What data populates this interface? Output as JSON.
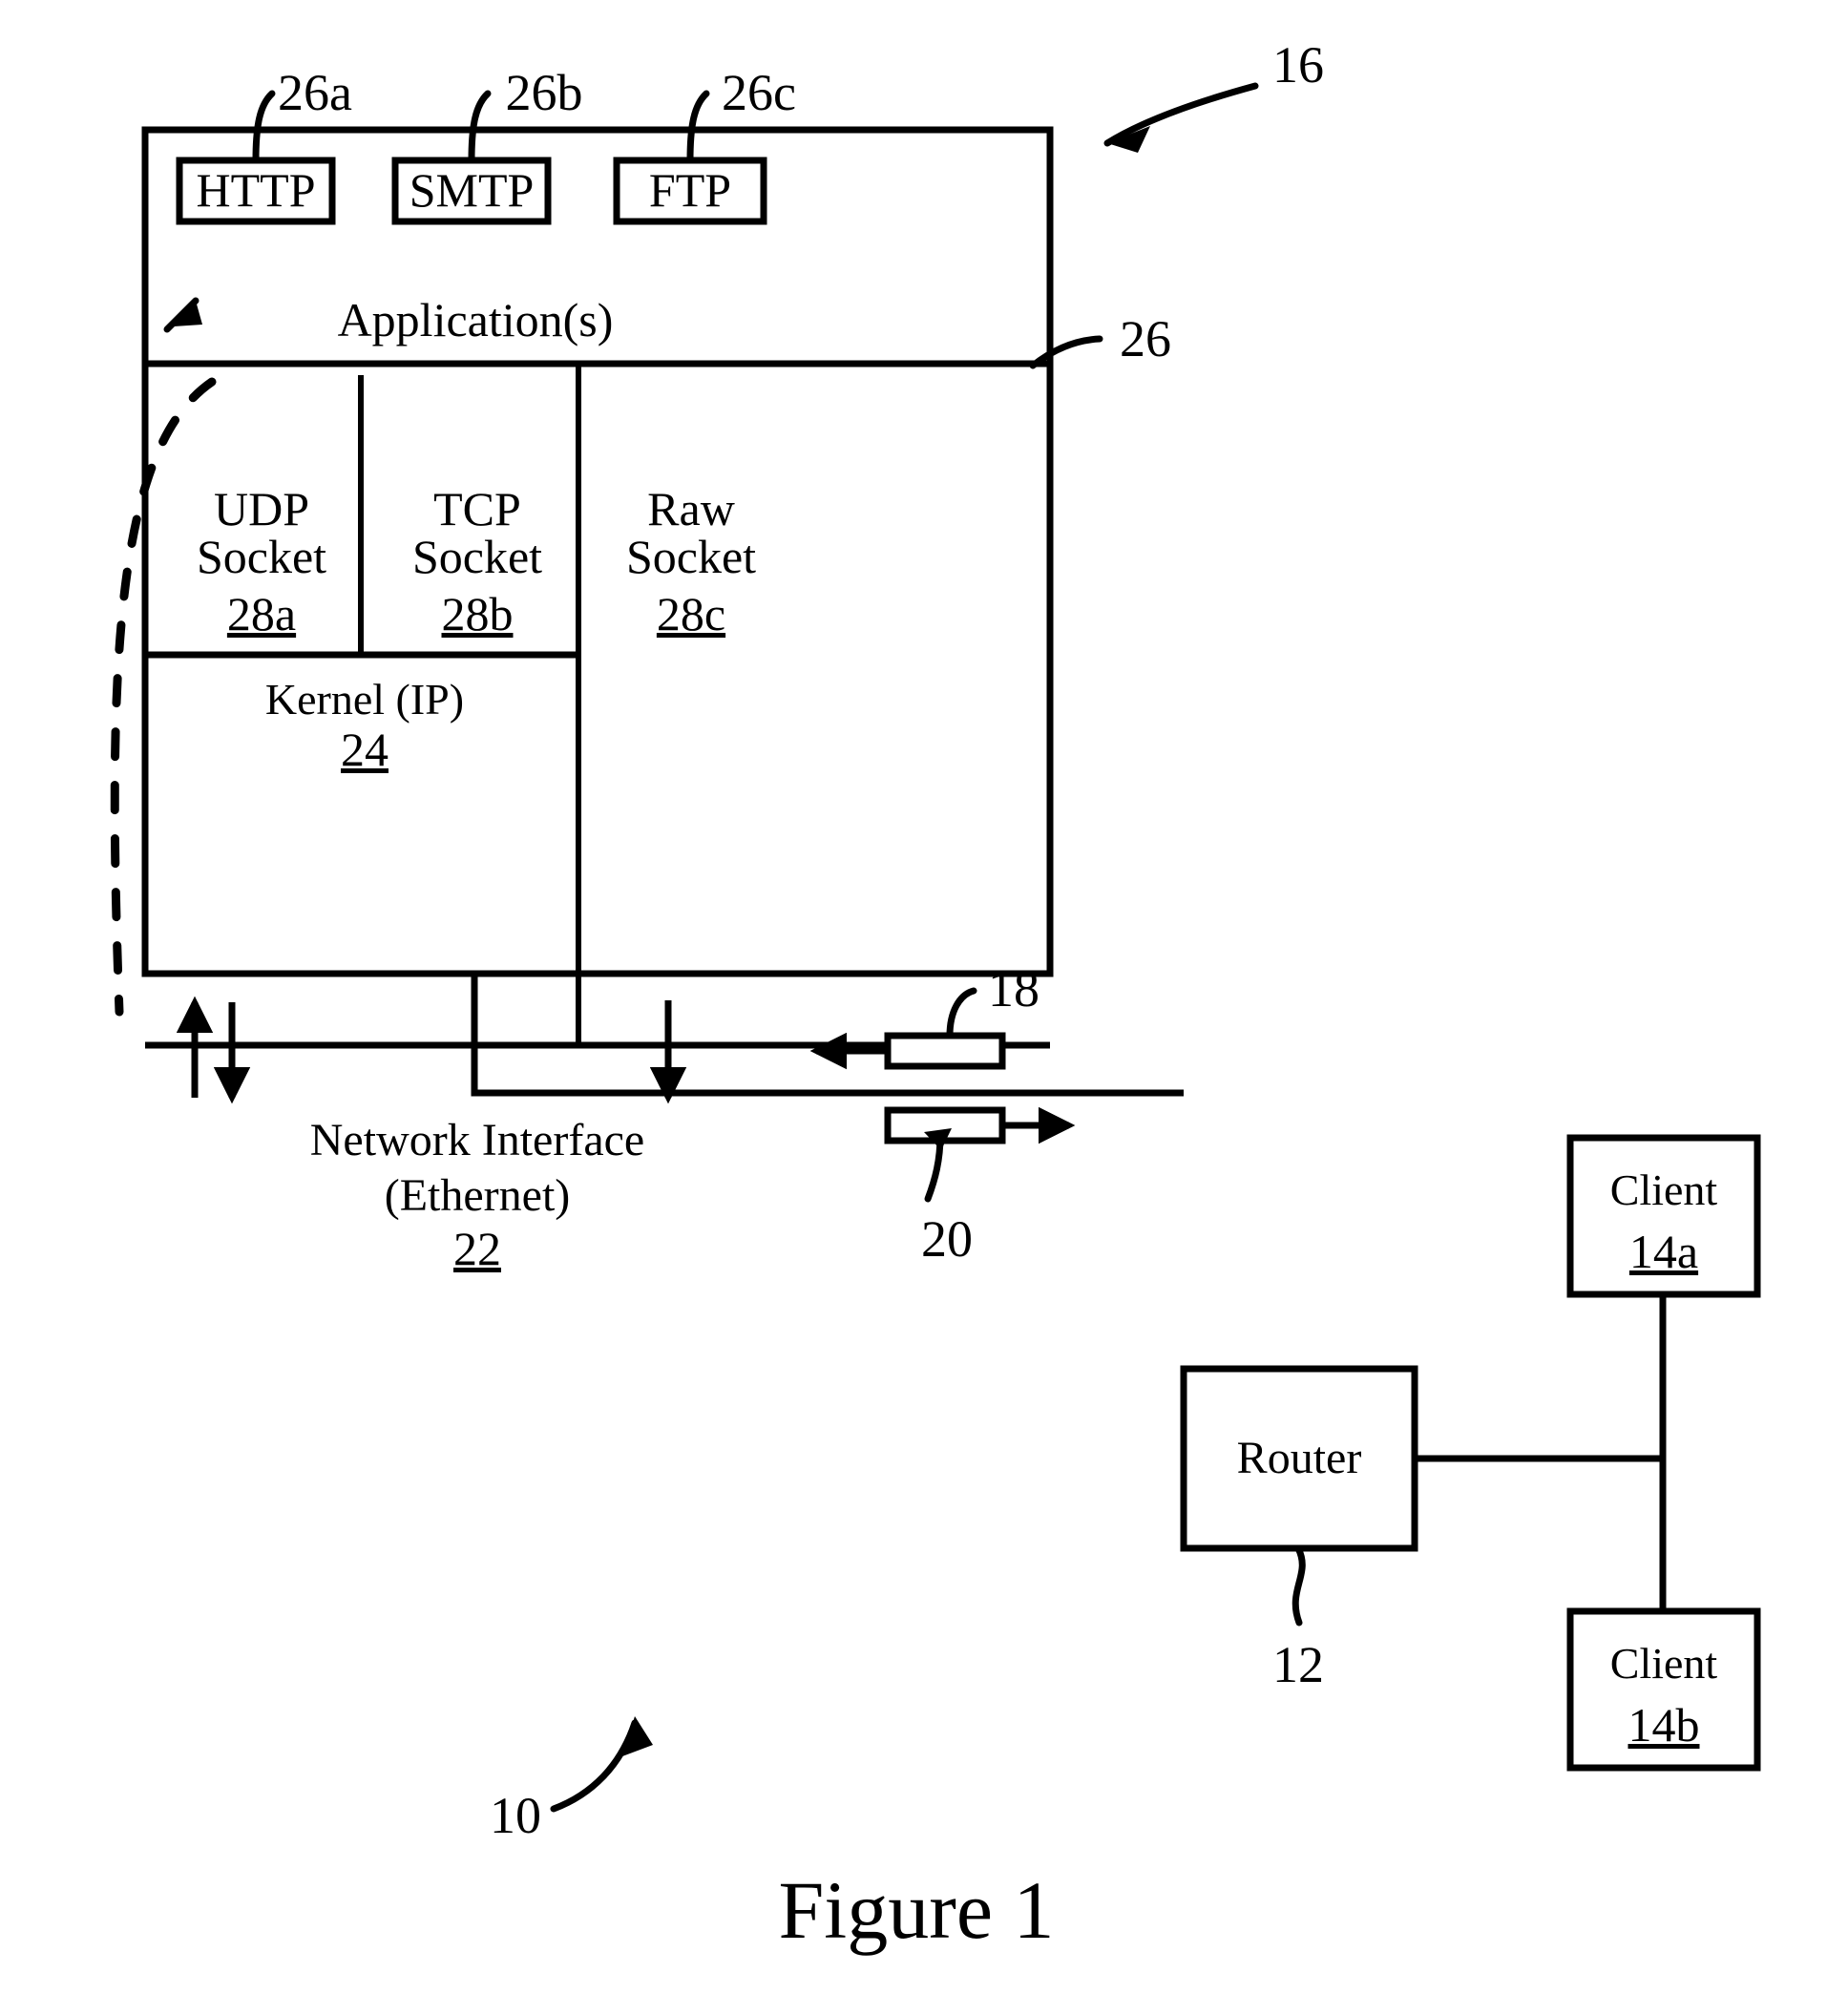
{
  "figure": {
    "caption": "Figure 1",
    "system_ref": "10",
    "server_ref": "16"
  },
  "server_stack": {
    "protocols": [
      {
        "label": "HTTP",
        "ref": "26a"
      },
      {
        "label": "SMTP",
        "ref": "26b"
      },
      {
        "label": "FTP",
        "ref": "26c"
      }
    ],
    "application_layer": {
      "label": "Application(s)",
      "ref": "26"
    },
    "sockets": [
      {
        "line1": "UDP",
        "line2": "Socket",
        "ref": "28a"
      },
      {
        "line1": "TCP",
        "line2": "Socket",
        "ref": "28b"
      },
      {
        "line1": "Raw",
        "line2": "Socket",
        "ref": "28c"
      }
    ],
    "kernel": {
      "label": "Kernel (IP)",
      "ref": "24"
    },
    "network_interface": {
      "line1": "Network Interface",
      "line2": "(Ethernet)",
      "ref": "22"
    }
  },
  "network": {
    "router": {
      "label": "Router",
      "ref": "12"
    },
    "clients": [
      {
        "label": "Client",
        "ref": "14a"
      },
      {
        "label": "Client",
        "ref": "14b"
      }
    ],
    "packets": [
      {
        "ref": "18",
        "direction": "inbound"
      },
      {
        "ref": "20",
        "direction": "outbound"
      }
    ]
  },
  "colors": {
    "ink": "#000000",
    "paper": "#ffffff"
  }
}
